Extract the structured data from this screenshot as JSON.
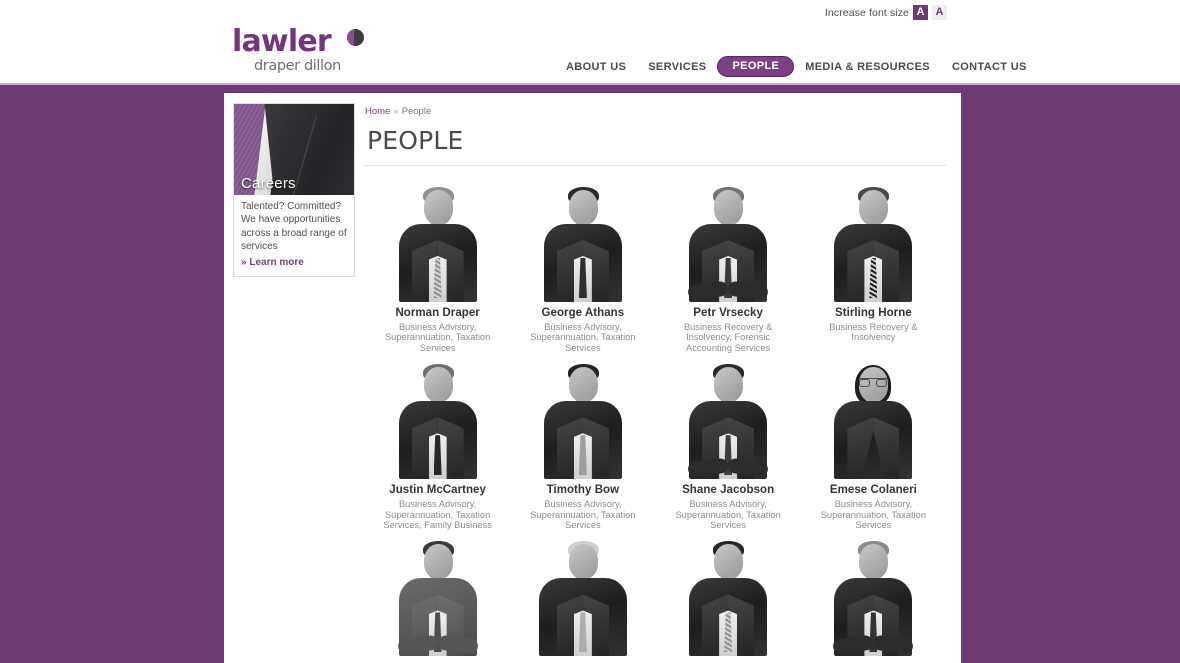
{
  "header": {
    "fontsize": {
      "label": "Increase font size",
      "small_label": "A",
      "large_label": "A"
    },
    "logo": {
      "word": "lawler",
      "sub": "draper dillon"
    },
    "nav": [
      {
        "label": "ABOUT US",
        "active": false
      },
      {
        "label": "SERVICES",
        "active": false
      },
      {
        "label": "PEOPLE",
        "active": true
      },
      {
        "label": "MEDIA & RESOURCES",
        "active": false
      },
      {
        "label": "CONTACT US",
        "active": false
      }
    ]
  },
  "breadcrumb": {
    "home": "Home",
    "separator": "»",
    "current": "People"
  },
  "main": {
    "title": "PEOPLE"
  },
  "promo": {
    "title": "Careers",
    "body": "Talented? Committed? We have opportunities across a broad range of services",
    "link": "» Learn more"
  },
  "people": [
    {
      "name": "Norman Draper",
      "role": "Business Advisory, Superannuation, Taxation Services"
    },
    {
      "name": "George Athans",
      "role": "Business Advisory, Superannuation, Taxation Services"
    },
    {
      "name": "Petr Vrsecky",
      "role": "Business Recovery & Insolvency, Forensic Accounting Services"
    },
    {
      "name": "Stirling Horne",
      "role": "Business Recovery & Insolvency"
    },
    {
      "name": "Justin McCartney",
      "role": "Business Advisory, Superannuation, Taxation Services, Family Business"
    },
    {
      "name": "Timothy Bow",
      "role": "Business Advisory, Superannuation, Taxation Services"
    },
    {
      "name": "Shane Jacobson",
      "role": "Business Advisory, Superannuation, Taxation Services"
    },
    {
      "name": "Emese Colaneri",
      "role": "Business Advisory, Superannuation, Taxation Services"
    },
    {
      "name": "",
      "role": ""
    },
    {
      "name": "",
      "role": ""
    },
    {
      "name": "",
      "role": ""
    },
    {
      "name": "",
      "role": ""
    }
  ],
  "colors": {
    "brand_purple": "#6d3a74",
    "nav_active": "#7b4184",
    "page_background": "#6d3a74",
    "card_background": "#ffffff",
    "text_dark": "#333333",
    "text_muted": "#8c8c8c"
  }
}
